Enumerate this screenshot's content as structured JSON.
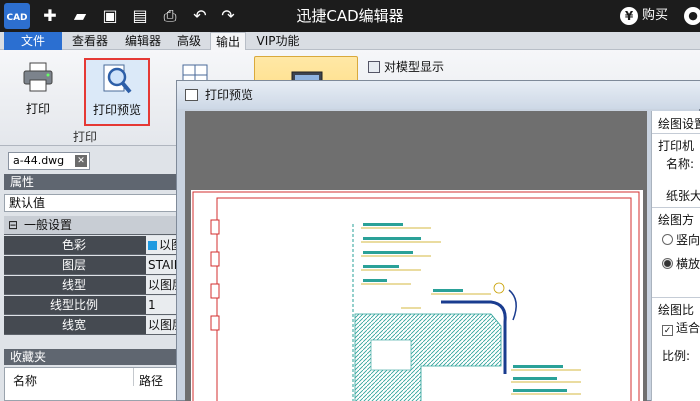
{
  "titlebar": {
    "logo": "CAD",
    "title": "迅捷CAD编辑器",
    "buy_label": "购买",
    "buy_icon_glyph": "¥",
    "quick_tools": [
      "new-icon",
      "open-icon",
      "save-icon",
      "save-as-icon",
      "print-icon",
      "undo-icon",
      "redo-icon"
    ]
  },
  "tabs": [
    "文件",
    "查看器",
    "编辑器",
    "高级",
    "输出",
    "VIP功能"
  ],
  "active_tab": "输出",
  "ribbon": {
    "print_label": "打印",
    "preview_label": "打印预览",
    "group_label": "打印",
    "model_display_label": "对模型显示"
  },
  "left_panel": {
    "doc_tab": "a-44.dwg",
    "properties_header": "属性",
    "default_value": "默认值",
    "general_group": "一般设置",
    "properties": [
      {
        "key": "色彩",
        "value": "以图"
      },
      {
        "key": "图层",
        "value": "STAIR"
      },
      {
        "key": "线型",
        "value": "以图层"
      },
      {
        "key": "线型比例",
        "value": "1"
      },
      {
        "key": "线宽",
        "value": "以图层"
      }
    ],
    "favorites_header": "收藏夹",
    "fav_columns": [
      "名称",
      "路径"
    ]
  },
  "dialog": {
    "title": "打印预览",
    "settings": {
      "plot_settings": "绘图设置",
      "printer": "打印机",
      "name_label": "名称:",
      "paper_size": "纸张大",
      "orientation": "绘图方",
      "portrait": "竖向",
      "landscape": "横放",
      "scale": "绘图比",
      "fit": "适合",
      "ratio": "比例:"
    }
  },
  "colors": {
    "accent": "#2b6fd1",
    "highlight_border": "#e53935",
    "drawing_frame": "#d32f2f",
    "hatch": "#2aa198"
  }
}
